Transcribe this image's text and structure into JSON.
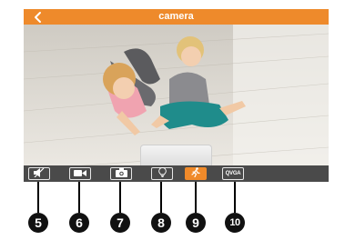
{
  "header": {
    "title": "camera"
  },
  "toolbar": {
    "buttons": [
      {
        "name": "mute-button",
        "icon": "speaker-muted-icon",
        "active": false
      },
      {
        "name": "record-button",
        "icon": "video-camera-icon",
        "active": false
      },
      {
        "name": "snapshot-button",
        "icon": "camera-icon",
        "active": false
      },
      {
        "name": "light-button",
        "icon": "lightbulb-icon",
        "active": false
      },
      {
        "name": "motion-button",
        "icon": "running-person-icon",
        "active": true
      },
      {
        "name": "resolution-button",
        "icon": "qvga-icon",
        "label": "QVGA",
        "active": false
      }
    ]
  },
  "callouts": [
    "5",
    "6",
    "7",
    "8",
    "9",
    "10"
  ],
  "colors": {
    "accent": "#ee8a2b",
    "toolbar": "#4a4a4a"
  }
}
